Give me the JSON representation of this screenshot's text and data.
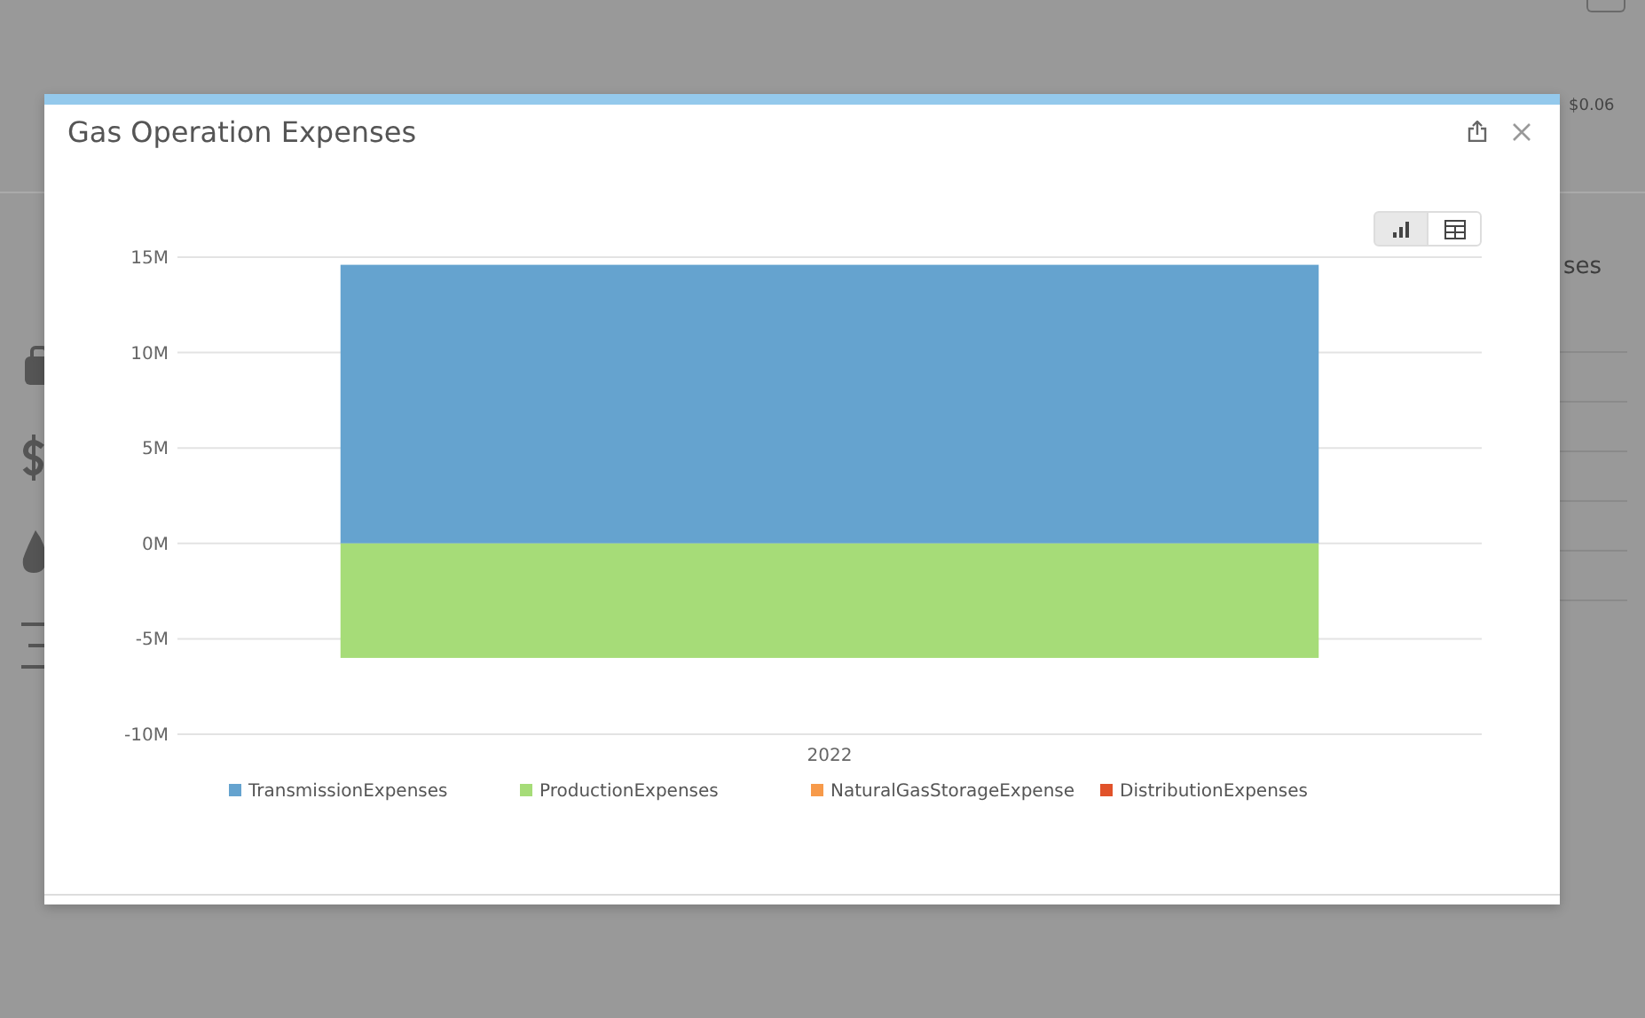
{
  "background": {
    "price_fragment": "$0.06",
    "heading_fragment": "ses"
  },
  "dialog": {
    "title": "Gas Operation Expenses",
    "view_toggle": [
      {
        "kind": "chart",
        "selected": true
      },
      {
        "kind": "table",
        "selected": false
      }
    ],
    "chart_data": {
      "type": "bar",
      "stacked": true,
      "grid": true,
      "legend": true,
      "categories": [
        "2022"
      ],
      "ylim": [
        -10000000,
        15000000
      ],
      "yticks": [
        {
          "value": 15000000,
          "label": "15M"
        },
        {
          "value": 10000000,
          "label": "10M"
        },
        {
          "value": 5000000,
          "label": "5M"
        },
        {
          "value": 0,
          "label": "0M"
        },
        {
          "value": -5000000,
          "label": "-5M"
        },
        {
          "value": -10000000,
          "label": "-10M"
        }
      ],
      "series": [
        {
          "name": "TransmissionExpenses",
          "color": "#65a3cf",
          "values": [
            14600000
          ]
        },
        {
          "name": "ProductionExpenses",
          "color": "#a6dc78",
          "values": [
            -6000000
          ]
        },
        {
          "name": "NaturalGasStorageExpense",
          "color": "#f79a4a",
          "values": [
            0
          ]
        },
        {
          "name": "DistributionExpenses",
          "color": "#e1522a",
          "values": [
            0
          ]
        }
      ]
    }
  }
}
